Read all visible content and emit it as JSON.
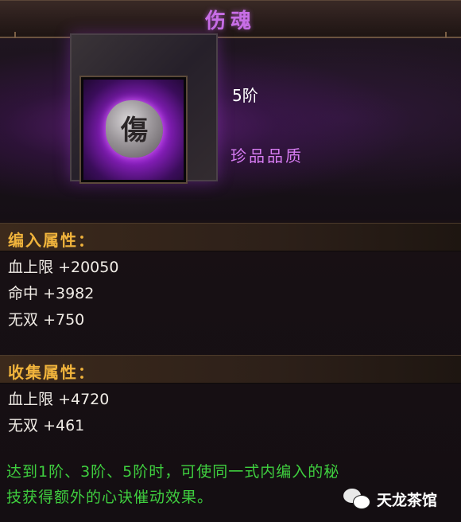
{
  "window": {
    "title": "伤魂"
  },
  "item": {
    "icon_glyph": "傷",
    "tier": "5阶",
    "quality": "珍品品质"
  },
  "embed_section": {
    "header": "编入属性：",
    "stats": [
      {
        "name": "血上限",
        "value": "+20050"
      },
      {
        "name": "命中",
        "value": "+3982"
      },
      {
        "name": "无双",
        "value": "+750"
      }
    ]
  },
  "collect_section": {
    "header": "收集属性：",
    "stats": [
      {
        "name": "血上限",
        "value": "+4720"
      },
      {
        "name": "无双",
        "value": "+461"
      }
    ]
  },
  "note": {
    "line1": "达到1阶、3阶、5阶时，可使同一式内编入的秘",
    "line2": "技获得额外的心诀催动效果。"
  },
  "watermark": {
    "text": "天龙茶馆",
    "icon": "wechat-icon"
  },
  "colors": {
    "title": "#c86ee6",
    "quality": "#d77cf2",
    "section_header": "#f1b43c",
    "note": "#3fcf3f"
  }
}
